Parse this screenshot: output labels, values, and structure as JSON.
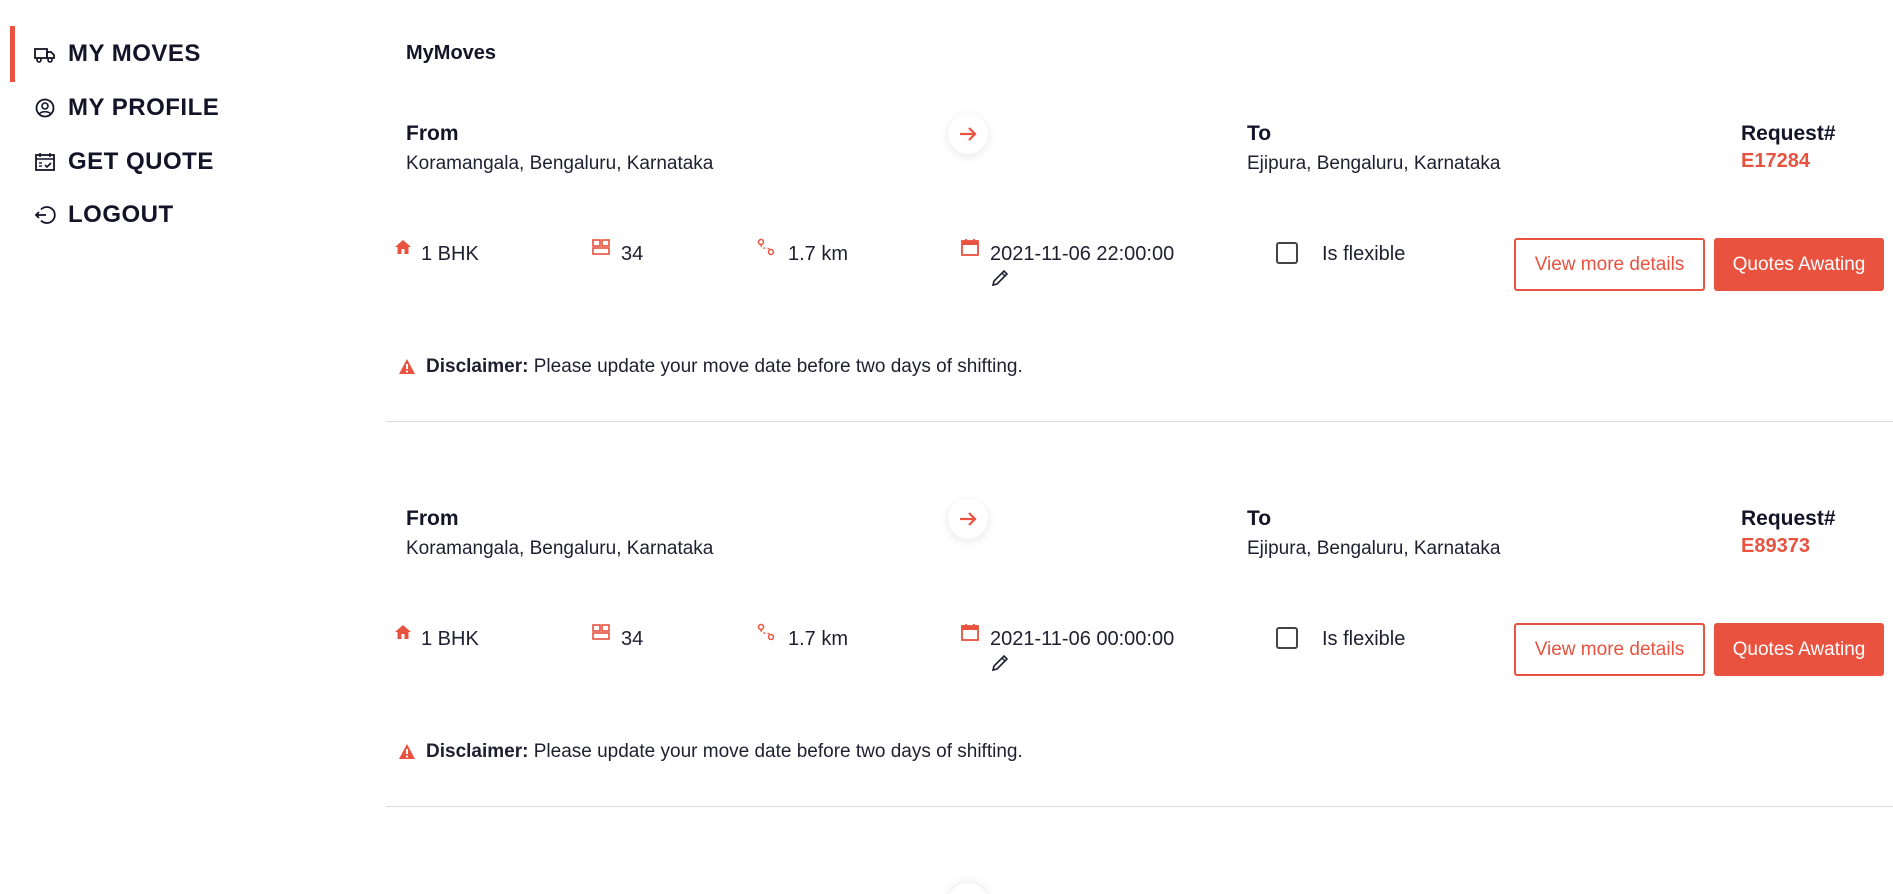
{
  "sidebar": {
    "items": [
      {
        "label": "MY MOVES",
        "icon": "truck-icon",
        "active": true
      },
      {
        "label": "MY PROFILE",
        "icon": "user-circle-icon",
        "active": false
      },
      {
        "label": "GET QUOTE",
        "icon": "calendar-check-icon",
        "active": false
      },
      {
        "label": "LOGOUT",
        "icon": "logout-icon",
        "active": false
      }
    ]
  },
  "main": {
    "title": "MyMoves",
    "common": {
      "from_label": "From",
      "to_label": "To",
      "request_label": "Request#",
      "flexible_label": "Is flexible",
      "view_details_label": "View more details",
      "quotes_label": "Quotes Awating",
      "disclaimer_bold": "Disclaimer:",
      "disclaimer_text": " Please update your move date before two days of shifting."
    },
    "moves": [
      {
        "from": "Koramangala, Bengaluru, Karnataka",
        "to": "Ejipura, Bengaluru, Karnataka",
        "request_id": "E17284",
        "house_type": "1 BHK",
        "items": "34",
        "distance": "1.7 km",
        "date": "2021-11-06 22:00:00",
        "flexible": false
      },
      {
        "from": "Koramangala, Bengaluru, Karnataka",
        "to": "Ejipura, Bengaluru, Karnataka",
        "request_id": "E89373",
        "house_type": "1 BHK",
        "items": "34",
        "distance": "1.7 km",
        "date": "2021-11-06 00:00:00",
        "flexible": false
      }
    ]
  },
  "colors": {
    "accent": "#e8523f",
    "text": "#141428",
    "divider": "#dcdcdc"
  }
}
